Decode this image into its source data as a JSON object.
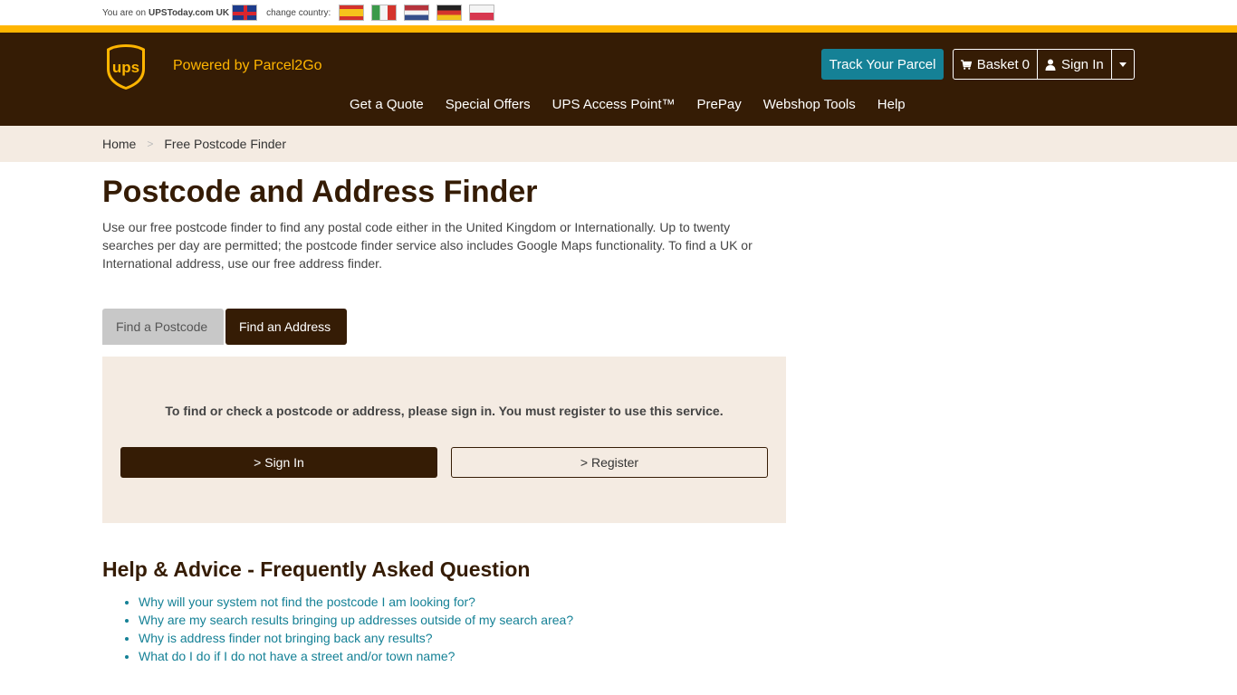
{
  "topbar": {
    "location_prefix": "You are on",
    "location_site": "UPSToday.com UK",
    "change_country": "change country:",
    "flags": [
      "uk-flag-icon",
      "spain-flag-icon",
      "italy-flag-icon",
      "netherlands-flag-icon",
      "germany-flag-icon",
      "poland-flag-icon"
    ]
  },
  "header": {
    "logo_text": "ups",
    "powered_by": "Powered by Parcel2Go",
    "track_button": "Track Your Parcel",
    "basket_label": "Basket",
    "basket_count": "0",
    "sign_in": "Sign In",
    "nav": [
      "Get a Quote",
      "Special Offers",
      "UPS Access Point™",
      "PrePay",
      "Webshop Tools",
      "Help"
    ]
  },
  "breadcrumb": {
    "home": "Home",
    "separator": ">",
    "current": "Free Postcode Finder"
  },
  "main": {
    "title": "Postcode and Address Finder",
    "intro": "Use our free postcode finder to find any postal code either in the United Kingdom or Internationally. Up to twenty searches per day are permitted; the postcode finder service also includes Google Maps functionality. To find a UK or International address, use our free address finder.",
    "tabs": [
      {
        "label": "Find a Postcode",
        "active": false
      },
      {
        "label": "Find an Address",
        "active": true
      }
    ],
    "panel_message": "To find or check a postcode or address, please sign in. You must register to use this service.",
    "sign_in_button": "> Sign In",
    "register_button": "> Register"
  },
  "faq": {
    "title": "Help & Advice - Frequently Asked Question",
    "items": [
      "Why will your system not find the postcode I am looking for?",
      "Why are my search results bringing up addresses outside of my search area?",
      "Why is address finder not bringing back any results?",
      "What do I do if I do not have a street and/or town name?"
    ]
  },
  "colors": {
    "brand_brown": "#351c05",
    "brand_gold": "#ffb500",
    "teal": "#158196",
    "panel_bg": "#f4ebe2"
  }
}
